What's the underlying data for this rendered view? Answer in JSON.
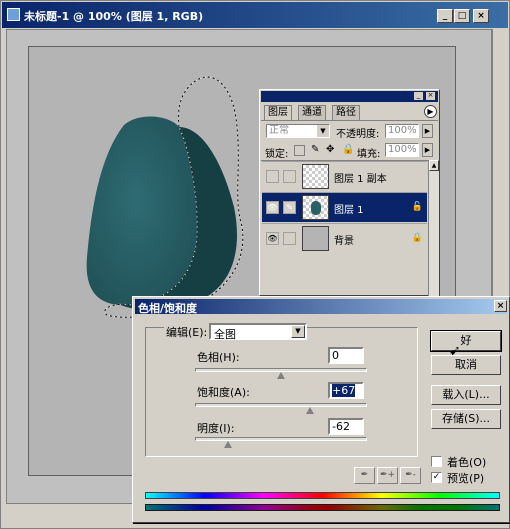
{
  "document": {
    "title": "未标题-1 @ 100% (图层 1, RGB)"
  },
  "layers_panel": {
    "tabs": [
      "图层",
      "通道",
      "路径"
    ],
    "blend_mode": "正常",
    "opacity_label": "不透明度:",
    "opacity_value": "100%",
    "lock_label": "锁定:",
    "fill_label": "填充:",
    "fill_value": "100%",
    "layers": [
      {
        "name": "图层 1 副本",
        "visible": false,
        "selected": false
      },
      {
        "name": "图层 1",
        "visible": true,
        "selected": true
      },
      {
        "name": "背景",
        "visible": true,
        "selected": false
      }
    ]
  },
  "hue_saturation": {
    "title": "色相/饱和度",
    "edit_label": "编辑(E):",
    "edit_value": "全图",
    "hue_label": "色相(H):",
    "hue_value": "0",
    "saturation_label": "饱和度(A):",
    "saturation_value": "+67",
    "lightness_label": "明度(I):",
    "lightness_value": "-62",
    "ok_label": "好",
    "cancel_label": "取消",
    "load_label": "载入(L)...",
    "save_label": "存储(S)...",
    "colorize_label": "着色(O)",
    "colorize_checked": false,
    "preview_label": "预览(P)",
    "preview_checked": true,
    "slider_levels": {
      "hue": 0.5,
      "saturation": 0.67,
      "lightness": 0.19
    }
  },
  "colors": {
    "shape": "#2a5f66",
    "title_bar": "#0a246a",
    "dialog_bg": "#d4d0c8"
  }
}
